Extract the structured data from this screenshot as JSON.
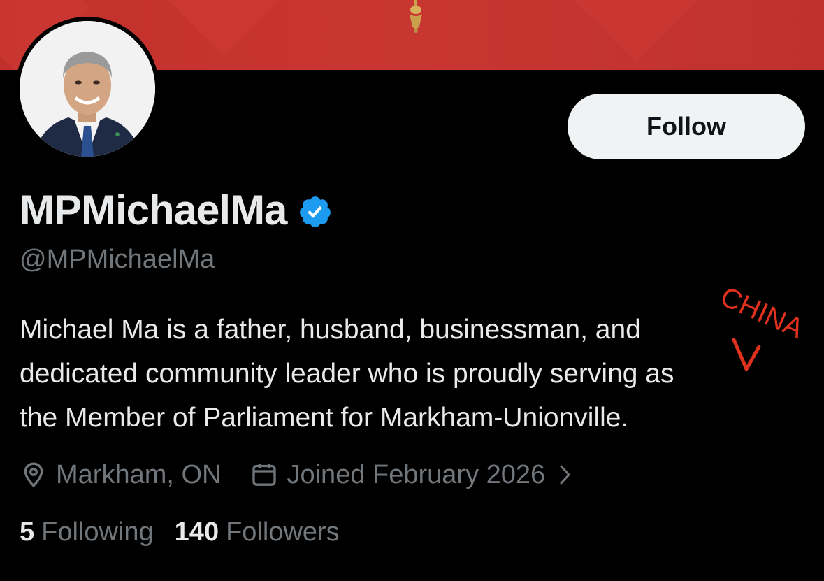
{
  "profile": {
    "display_name": "MPMichaelMa",
    "handle": "@MPMichaelMa",
    "bio_lines": [
      "Michael Ma is a father, husband, businessman, and",
      "dedicated community leader who is proudly serving as",
      "the Member of Parliament for Markham-Unionville."
    ],
    "location": "Markham, ON",
    "joined": "Joined February 2026",
    "following_count": "5",
    "following_label": "Following",
    "followers_count": "140",
    "followers_label": "Followers"
  },
  "actions": {
    "follow_label": "Follow"
  },
  "annotation": {
    "text": "CHINA",
    "color": "#e0301e"
  },
  "icons": {
    "verified": "verified-badge-icon",
    "location": "location-pin-icon",
    "calendar": "calendar-icon",
    "chevron": "chevron-right-icon"
  },
  "colors": {
    "banner": "#c93632",
    "verified": "#1d9bf0",
    "text_primary": "#e7e9ea",
    "text_secondary": "#71767b",
    "follow_bg": "#eff3f4"
  }
}
